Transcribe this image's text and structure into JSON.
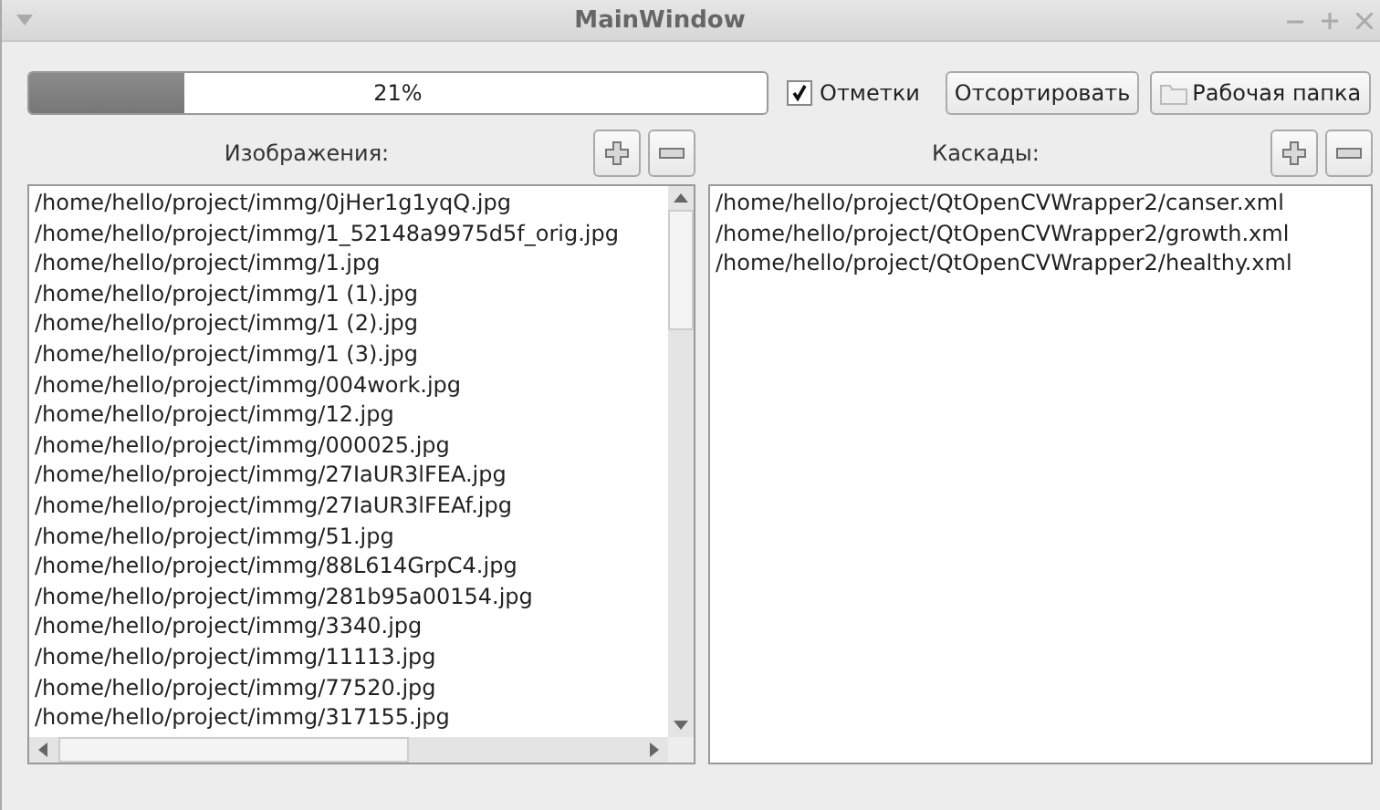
{
  "window": {
    "title": "MainWindow"
  },
  "toolbar": {
    "progress": {
      "level": 0.21,
      "reading": "21%"
    },
    "marks": {
      "label": "Отметки",
      "checked": true
    },
    "sort_button": "Отсортировать",
    "folder_button": "Рабочая папка"
  },
  "images": {
    "label": "Изображения:",
    "items": [
      "/home/hello/project/immg/0jHer1g1yqQ.jpg",
      "/home/hello/project/immg/1_52148a9975d5f_orig.jpg",
      "/home/hello/project/immg/1.jpg",
      "/home/hello/project/immg/1 (1).jpg",
      "/home/hello/project/immg/1 (2).jpg",
      "/home/hello/project/immg/1 (3).jpg",
      "/home/hello/project/immg/004work.jpg",
      "/home/hello/project/immg/12.jpg",
      "/home/hello/project/immg/000025.jpg",
      "/home/hello/project/immg/27IaUR3lFEA.jpg",
      "/home/hello/project/immg/27IaUR3lFEAf.jpg",
      "/home/hello/project/immg/51.jpg",
      "/home/hello/project/immg/88L614GrpC4.jpg",
      "/home/hello/project/immg/281b95a00154.jpg",
      "/home/hello/project/immg/3340.jpg",
      "/home/hello/project/immg/11113.jpg",
      "/home/hello/project/immg/77520.jpg",
      "/home/hello/project/immg/317155.jpg"
    ]
  },
  "cascades": {
    "label": "Каскады:",
    "items": [
      "/home/hello/project/QtOpenCVWrapper2/canser.xml",
      "/home/hello/project/QtOpenCVWrapper2/growth.xml",
      "/home/hello/project/QtOpenCVWrapper2/healthy.xml"
    ]
  }
}
